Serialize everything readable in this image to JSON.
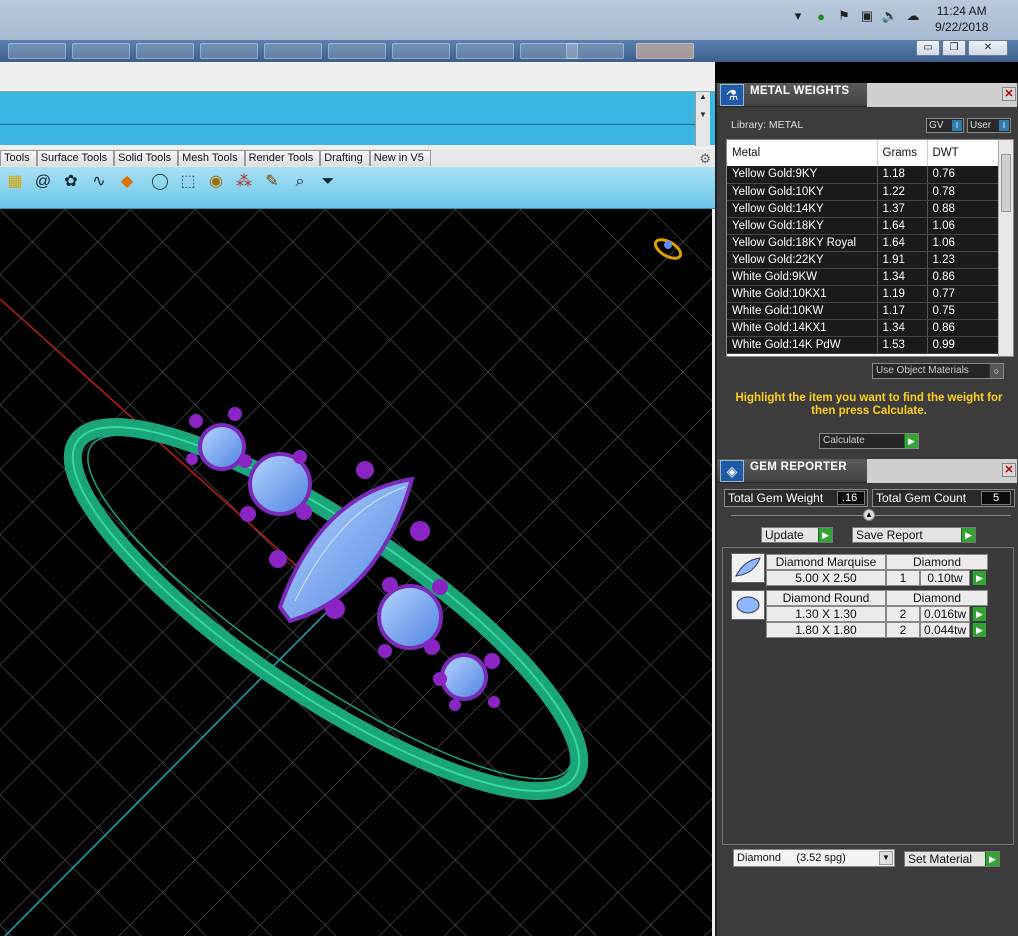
{
  "taskbar": {
    "time": "11:24 AM",
    "date": "9/22/2018",
    "tray_icons": [
      "chevron-up-icon",
      "security-icon",
      "flag-icon",
      "network-icon",
      "volume-icon",
      "cloud-icon"
    ]
  },
  "window_controls": {
    "minimize": "▭",
    "restore": "❐",
    "close": "✕"
  },
  "toolbar_tabs": [
    "Tools",
    "Surface Tools",
    "Solid Tools",
    "Mesh Tools",
    "Render Tools",
    "Drafting",
    "New in V5"
  ],
  "metal_weights": {
    "title": "METAL WEIGHTS",
    "library_label": "Library: METAL",
    "gv_label": "GV",
    "user_label": "User",
    "columns": [
      "Metal",
      "Grams",
      "DWT"
    ],
    "rows": [
      [
        "Yellow Gold:9KY",
        "1.18",
        "0.76"
      ],
      [
        "Yellow Gold:10KY",
        "1.22",
        "0.78"
      ],
      [
        "Yellow Gold:14KY",
        "1.37",
        "0.88"
      ],
      [
        "Yellow Gold:18KY",
        "1.64",
        "1.06"
      ],
      [
        "Yellow Gold:18KY Royal",
        "1.64",
        "1.06"
      ],
      [
        "Yellow Gold:22KY",
        "1.91",
        "1.23"
      ],
      [
        "White Gold:9KW",
        "1.34",
        "0.86"
      ],
      [
        "White Gold:10KX1",
        "1.19",
        "0.77"
      ],
      [
        "White Gold:10KW",
        "1.17",
        "0.75"
      ],
      [
        "White Gold:14KX1",
        "1.34",
        "0.86"
      ],
      [
        "White Gold:14K PdW",
        "1.53",
        "0.99"
      ]
    ],
    "use_object_materials": "Use Object Materials",
    "hint": "Highlight the item you want to find the weight for then press Calculate.",
    "calculate_label": "Calculate"
  },
  "gem_reporter": {
    "title": "GEM REPORTER",
    "total_weight_label": "Total Gem Weight",
    "total_weight_value": ".16",
    "total_count_label": "Total Gem Count",
    "total_count_value": "5",
    "update_label": "Update",
    "save_report_label": "Save Report",
    "groups": [
      {
        "name": "Diamond Marquise",
        "material": "Diamond",
        "rows": [
          {
            "size": "5.00 X 2.50",
            "count": "1",
            "weight": "0.10tw"
          }
        ]
      },
      {
        "name": "Diamond Round",
        "material": "Diamond",
        "rows": [
          {
            "size": "1.30 X 1.30",
            "count": "2",
            "weight": "0.016tw"
          },
          {
            "size": "1.80 X 1.80",
            "count": "2",
            "weight": "0.044tw"
          }
        ]
      }
    ],
    "material_select": "Diamond     (3.52 spg)",
    "set_material_label": "Set Material"
  },
  "colors": {
    "command_area": "#3bb6e3",
    "toolbar": "#6cc8ea",
    "ring_band": "#1aa57a",
    "stone": "#7ab0ff",
    "prong": "#8a24c4",
    "hint": "#ffd01a"
  }
}
